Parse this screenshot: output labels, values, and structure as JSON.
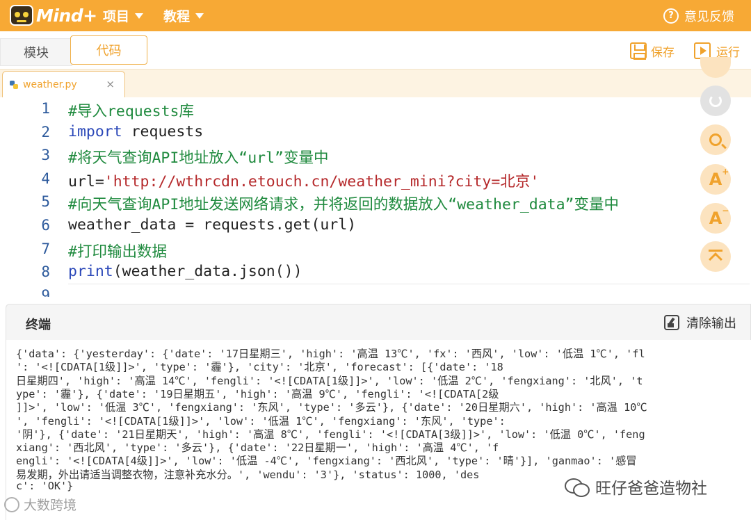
{
  "app": {
    "logo_text": "Mind+",
    "menus": [
      {
        "label": "项目"
      },
      {
        "label": "教程"
      }
    ],
    "feedback_label": "意见反馈"
  },
  "modes": {
    "block_label": "模块",
    "code_label": "代码",
    "save_label": "保存",
    "run_label": "运行"
  },
  "file_tab": {
    "name": "weather.py",
    "close": "×"
  },
  "editor": {
    "line_numbers": [
      "1",
      "2",
      "3",
      "4",
      "5",
      "6",
      "7",
      "8",
      "9"
    ],
    "lines": [
      [
        {
          "t": "#导入requests库",
          "c": "comment"
        }
      ],
      [
        {
          "t": "import",
          "c": "kw"
        },
        {
          "t": " requests",
          "c": ""
        }
      ],
      [
        {
          "t": "#将天气查询API地址放入“url”变量中",
          "c": "comment"
        }
      ],
      [
        {
          "t": "url=",
          "c": ""
        },
        {
          "t": "'http://wthrcdn.etouch.cn/weather_mini?city=北京'",
          "c": "str"
        }
      ],
      [
        {
          "t": "#向天气查询API地址发送网络请求，并将返回的数据放入“weather_data”变量中",
          "c": "comment"
        }
      ],
      [
        {
          "t": "weather_data = requests.get(url)",
          "c": ""
        }
      ],
      [
        {
          "t": "#打印输出数据",
          "c": "comment"
        }
      ],
      [
        {
          "t": "print",
          "c": "kw"
        },
        {
          "t": "(weather_data.json())",
          "c": ""
        }
      ]
    ]
  },
  "side_toolbar": {
    "font_increase": "A",
    "font_decrease": "A"
  },
  "terminal": {
    "title": "终端",
    "clear_label": "清除输出",
    "output_lines": [
      "{'data': {'yesterday': {'date': '17日星期三', 'high': '高温 13℃', 'fx': '西风', 'low': '低温 1℃', 'fl",
      "': '<![CDATA[1级]]>', 'type': '霾'}, 'city': '北京', 'forecast': [{'date': '18",
      "日星期四', 'high': '高温 14℃', 'fengli': '<![CDATA[1级]]>', 'low': '低温 2℃', 'fengxiang': '北风', 't",
      "ype': '霾'}, {'date': '19日星期五', 'high': '高温 9℃', 'fengli': '<![CDATA[2级",
      "]]>', 'low': '低温 3℃', 'fengxiang': '东风', 'type': '多云'}, {'date': '20日星期六', 'high': '高温 10℃",
      "', 'fengli': '<![CDATA[1级]]>', 'low': '低温 1℃', 'fengxiang': '东风', 'type':",
      "'阴'}, {'date': '21日星期天', 'high': '高温 8℃', 'fengli': '<![CDATA[3级]]>', 'low': '低温 0℃', 'feng",
      "xiang': '西北风', 'type': '多云'}, {'date': '22日星期一', 'high': '高温 4℃', 'f",
      "engli': '<![CDATA[4级]]>', 'low': '低温 -4℃', 'fengxiang': '西北风', 'type': '晴'}], 'ganmao': '感冒",
      "易发期，外出请适当调整衣物，注意补充水分。', 'wendu': '3'}, 'status': 1000, 'des",
      "c': 'OK'}"
    ]
  },
  "watermarks": {
    "left": "大数跨境",
    "right": "旺仔爸爸造物社"
  }
}
